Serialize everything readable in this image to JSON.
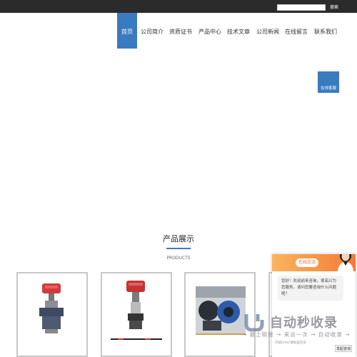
{
  "search": {
    "placeholder": "",
    "button_label": "搜索"
  },
  "nav": {
    "items": [
      {
        "label": "首页",
        "active": true
      },
      {
        "label": "公司简介"
      },
      {
        "label": "资质证书"
      },
      {
        "label": "产品中心"
      },
      {
        "label": "技术文章"
      },
      {
        "label": "公司新闻"
      },
      {
        "label": "在线留言"
      },
      {
        "label": "联系我们"
      }
    ]
  },
  "online_service_tab": "在线客服",
  "products": {
    "title": "产品展示",
    "subtitle": "PRODUCTS"
  },
  "chat": {
    "header_button": "在线交流",
    "message": "您好！欢迎前来咨询，很高兴为您服务，请问您要咨询什么问题呢？",
    "input_hint": "可按Enter键发送咨询",
    "send_label": "发起咨询"
  },
  "watermark": {
    "title": "自动秒收录",
    "subtitle": "→ 最上链接 → 来访一次 → 自动收录 →"
  },
  "colors": {
    "accent": "#3a7bc0",
    "chat_orange": "#f47a35",
    "topbar": "#2b2b2b"
  }
}
